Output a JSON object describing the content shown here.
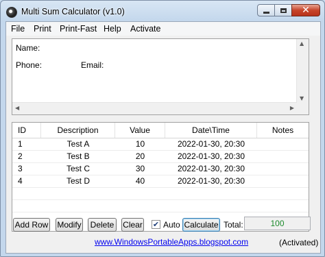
{
  "window": {
    "title": "Multi Sum Calculator (v1.0)"
  },
  "menu": [
    "File",
    "Print",
    "Print-Fast",
    "Help",
    "Activate"
  ],
  "info": {
    "name_label": "Name:",
    "phone_label": "Phone:",
    "email_label": "Email:"
  },
  "table": {
    "columns": [
      "ID",
      "Description",
      "Value",
      "Date\\Time",
      "Notes"
    ],
    "rows": [
      {
        "id": "1",
        "description": "Test A",
        "value": "10",
        "datetime": "2022-01-30, 20:30",
        "notes": ""
      },
      {
        "id": "2",
        "description": "Test B",
        "value": "20",
        "datetime": "2022-01-30, 20:30",
        "notes": ""
      },
      {
        "id": "3",
        "description": "Test C",
        "value": "30",
        "datetime": "2022-01-30, 20:30",
        "notes": ""
      },
      {
        "id": "4",
        "description": "Test D",
        "value": "40",
        "datetime": "2022-01-30, 20:30",
        "notes": ""
      }
    ]
  },
  "buttons": {
    "add_row": "Add Row",
    "modify": "Modify",
    "delete": "Delete",
    "clear": "Clear",
    "calculate": "Calculate"
  },
  "auto": {
    "label": "Auto",
    "checked": true
  },
  "total": {
    "label": "Total:",
    "value": "100",
    "color": "#1a8a2a"
  },
  "footer": {
    "link": "www.WindowsPortableApps.blogspot.com",
    "status": "(Activated)"
  }
}
